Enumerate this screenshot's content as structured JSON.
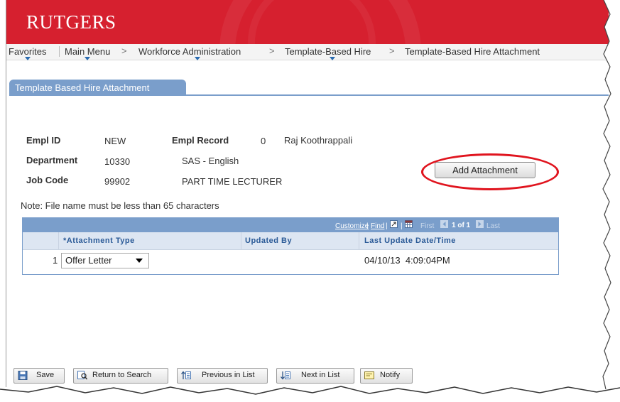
{
  "header": {
    "logo": "RUTGERS",
    "brand_color": "#d6202f"
  },
  "nav": {
    "favorites": "Favorites",
    "main_menu": "Main Menu",
    "crumb1": "Workforce Administration",
    "crumb2": "Template-Based Hire",
    "crumb3": "Template-Based Hire Attachment",
    "separator": ">"
  },
  "tab": {
    "label": "Template Based Hire Attachment"
  },
  "fields": {
    "empl_id_label": "Empl ID",
    "empl_id_value": "NEW",
    "empl_record_label": "Empl Record",
    "empl_record_value": "0",
    "name_value": "Raj Koothrappali",
    "department_label": "Department",
    "department_value": "10330",
    "department_desc": "SAS - English",
    "job_code_label": "Job Code",
    "job_code_value": "99902",
    "job_code_desc": "PART TIME LECTURER"
  },
  "add_attachment_label": "Add Attachment",
  "note": "Note: File name must be less than 65 characters",
  "grid": {
    "customize": "Customize",
    "find": "Find",
    "first": "First",
    "range": "1 of 1",
    "last": "Last",
    "col_attachment_type": "*Attachment Type",
    "col_updated_by": "Updated By",
    "col_last_update": "Last Update Date/Time",
    "rows": [
      {
        "num": "1",
        "attachment_type": "Offer Letter",
        "updated_by": "",
        "last_update": "04/10/13  4:09:04PM"
      }
    ]
  },
  "footer": {
    "save": "Save",
    "return_to_search": "Return to Search",
    "previous_in_list": "Previous in List",
    "next_in_list": "Next in List",
    "notify": "Notify"
  }
}
